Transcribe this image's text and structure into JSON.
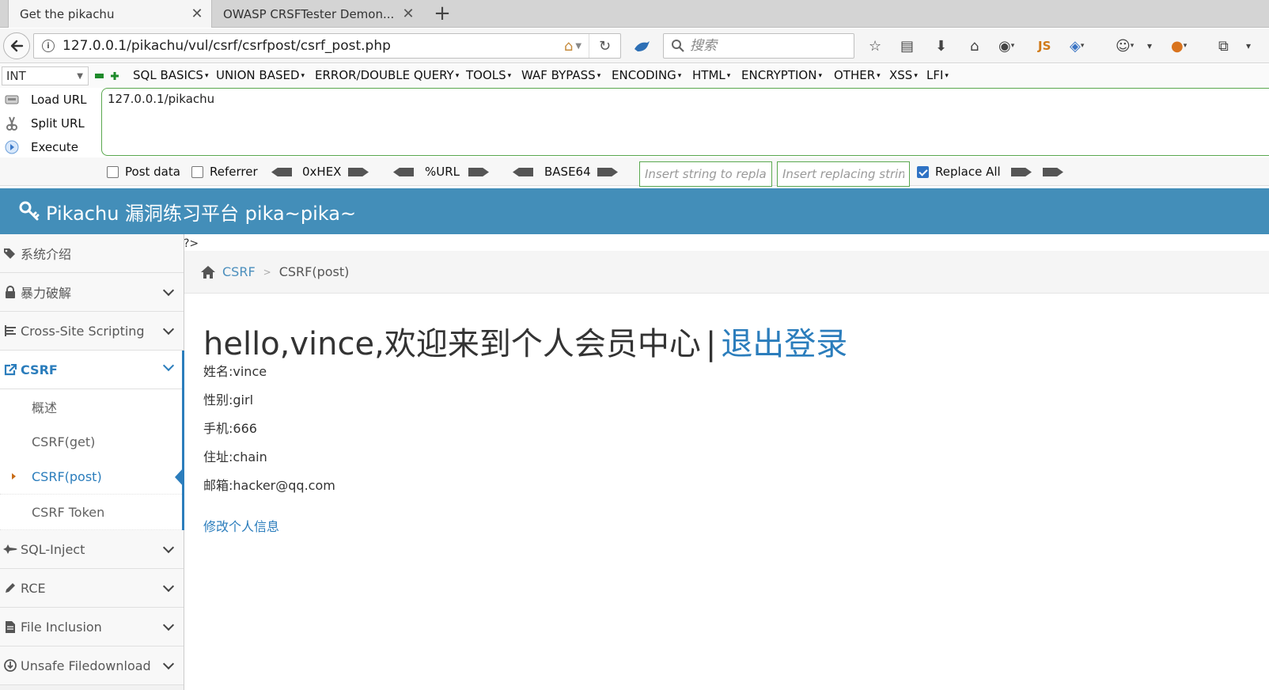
{
  "browser": {
    "tabs": [
      {
        "title": "Get the pikachu",
        "active": true
      },
      {
        "title": "OWASP CRSFTester Demon...",
        "active": false
      }
    ],
    "url": "127.0.0.1/pikachu/vul/csrf/csrfpost/csrf_post.php",
    "search_placeholder": "搜索",
    "js_label": "JS"
  },
  "hackbar": {
    "type_select": "INT",
    "menu": [
      "SQL BASICS",
      "UNION BASED",
      "ERROR/DOUBLE QUERY",
      "TOOLS",
      "WAF BYPASS",
      "ENCODING",
      "HTML",
      "ENCRYPTION",
      "OTHER",
      "XSS",
      "LFI"
    ],
    "load_url": "Load URL",
    "split_url": "Split URL",
    "execute": "Execute",
    "url_value": "127.0.0.1/pikachu",
    "post_data": "Post data",
    "referrer": "Referrer",
    "hex": "0xHEX",
    "url_enc": "%URL",
    "base64": "BASE64",
    "replace_placeholder": "Insert string to replace",
    "replacing_placeholder": "Insert replacing string",
    "replace_all": "Replace All"
  },
  "site": {
    "title": "Pikachu 漏洞练习平台 pika~pika~",
    "leaked_code": "?>",
    "sidebar": [
      {
        "label": "系统介绍"
      },
      {
        "label": "暴力破解"
      },
      {
        "label": "Cross-Site Scripting"
      },
      {
        "label": "CSRF"
      },
      {
        "label": "SQL-Inject"
      },
      {
        "label": "RCE"
      },
      {
        "label": "File Inclusion"
      },
      {
        "label": "Unsafe Filedownload"
      }
    ],
    "csrf_sub": [
      "概述",
      "CSRF(get)",
      "CSRF(post)",
      "CSRF Token"
    ],
    "breadcrumb": {
      "link": "CSRF",
      "current": "CSRF(post)"
    },
    "welcome": "hello,vince,欢迎来到个人会员中心",
    "pipe": "|",
    "logout": "退出登录",
    "info": [
      "姓名:vince",
      "性别:girl",
      "手机:666",
      "住址:chain",
      "邮箱:hacker@qq.com"
    ],
    "edit_link": "修改个人信息"
  },
  "colors": {
    "header": "#438eb9",
    "accent": "#2b7dbc",
    "hackbar_green": "#5aa84f"
  }
}
